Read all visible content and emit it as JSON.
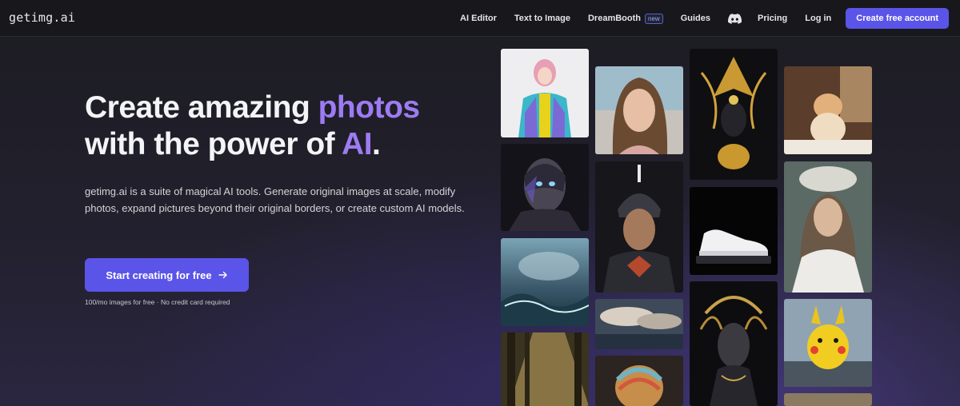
{
  "nav": {
    "logo": "getimg.ai",
    "links": [
      "AI Editor",
      "Text to Image",
      "DreamBooth",
      "Guides",
      "Pricing",
      "Log in"
    ],
    "new_badge": "new",
    "cta": "Create free account",
    "icons": {
      "discord": "discord-icon"
    }
  },
  "hero": {
    "title_line1_prefix": "Create amazing ",
    "title_line1_accent": "photos",
    "title_line2_prefix": "with the power of ",
    "title_line2_accent": "AI",
    "title_line2_suffix": ".",
    "description": "getimg.ai is a suite of magical AI tools. Generate original images at scale, modify photos, expand pictures beyond their original borders, or create custom AI models.",
    "button_label": "Start creating for free",
    "button_icon": "arrow-right-icon",
    "note": "100/mo images for free · No credit card required"
  },
  "colors": {
    "accent": "#9d7bf2",
    "primary_button": "#5b54e8",
    "nav_bg": "#18181c"
  },
  "gallery": [
    "image-anime-girl-puffer-jacket",
    "image-portrait-woman-beach",
    "image-golden-ornate-mask",
    "image-cat-on-table",
    "image-cyborg-face",
    "image-sci-fi-armored-man",
    "image-white-sneaker",
    "image-elf-woman-flower-crown",
    "image-stormy-sea",
    "image-clouds-over-sea",
    "image-dark-goddess-statue",
    "image-pikachu-figure",
    "image-sunlit-forest",
    "image-colorful-turban",
    "image-partial-bottom-tile"
  ]
}
